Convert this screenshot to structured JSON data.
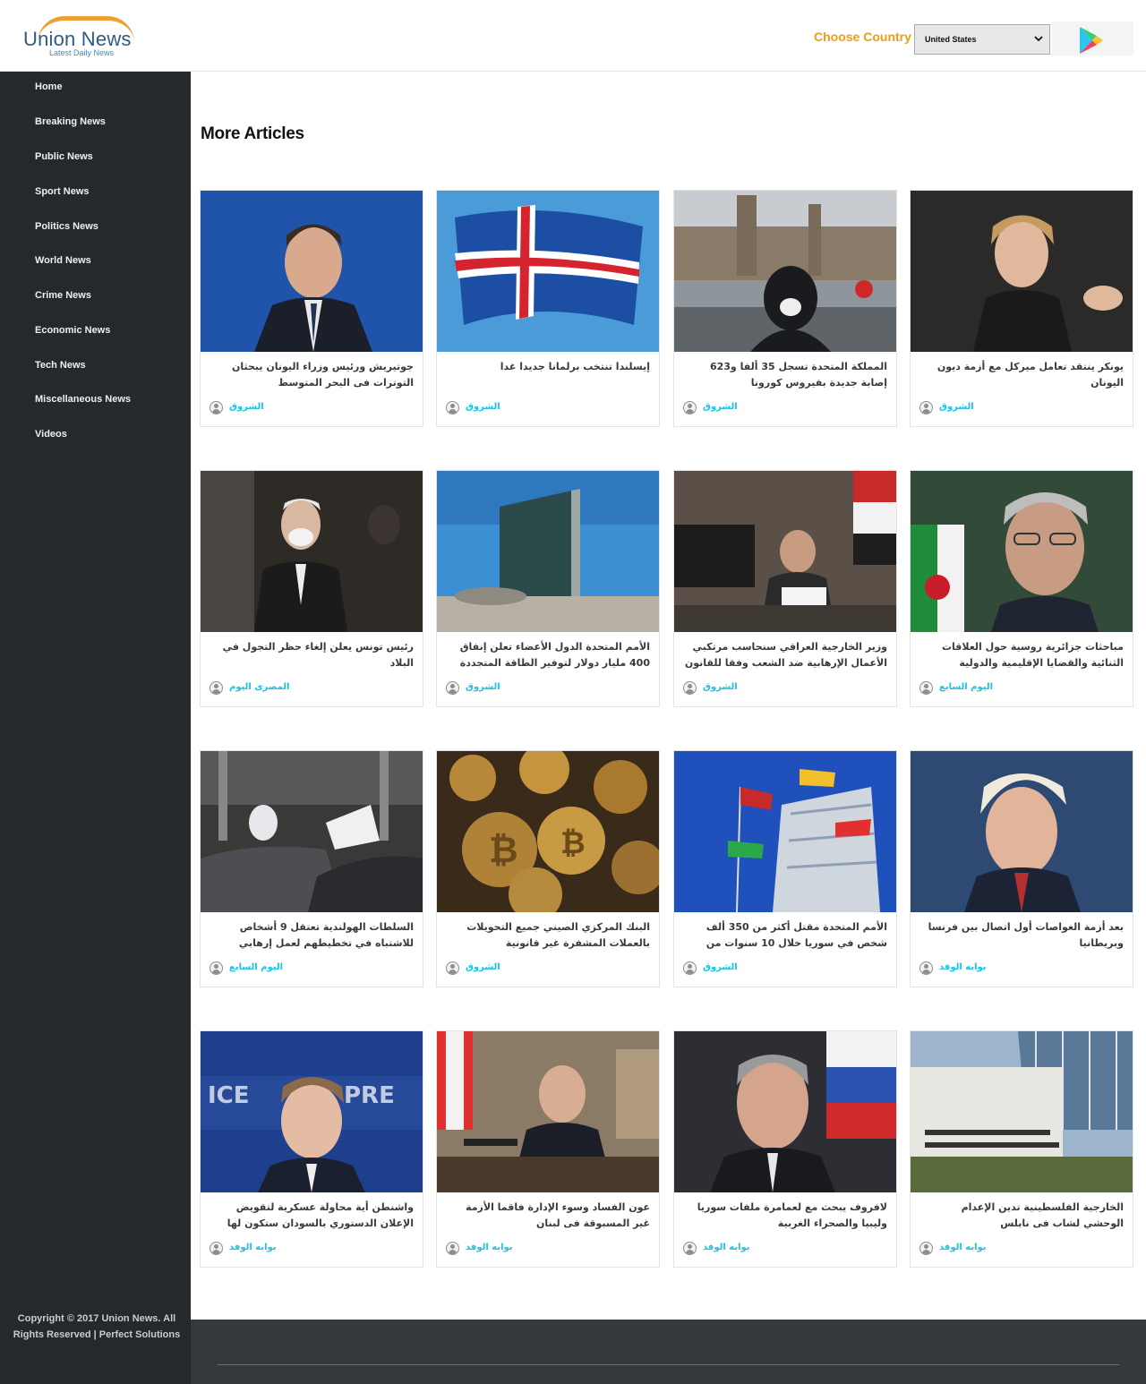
{
  "header": {
    "logo_name": "Union News",
    "logo_tagline": "Latest Daily News",
    "country_label": "Choose Country :",
    "country_selected": "United States",
    "play_icon": "google-play-icon"
  },
  "sidebar": {
    "items": [
      {
        "label": "Home"
      },
      {
        "label": "Breaking News"
      },
      {
        "label": "Public News"
      },
      {
        "label": "Sport News"
      },
      {
        "label": "Politics News"
      },
      {
        "label": "World News"
      },
      {
        "label": "Crime News"
      },
      {
        "label": "Economic News"
      },
      {
        "label": "Tech News"
      },
      {
        "label": "Miscellaneous News"
      },
      {
        "label": "Videos"
      }
    ],
    "copyright_line1": "Copyright © 2017 Union News. All",
    "copyright_line2": "Rights Reserved | Perfect Solutions"
  },
  "main": {
    "section_title": "More Articles",
    "articles": [
      {
        "title": "جوتيريش ورئيس وزراء اليونان يبحثان التوترات فى البحر المتوسط",
        "source": "الشروق"
      },
      {
        "title": "إيسلندا تنتخب برلمانا جديدا غدا",
        "source": "الشروق"
      },
      {
        "title": "المملكة المتحدة تسجل 35 ألفا و623 إصابة جديدة بفيروس كورونا",
        "source": "الشروق"
      },
      {
        "title": "يونكر ينتقد تعامل ميركل مع أزمة ديون اليونان",
        "source": "الشروق"
      },
      {
        "title": "رئيس تونس يعلن إلغاء حظر التجول في البلاد",
        "source": "المصرى اليوم"
      },
      {
        "title": "الأمم المتحدة الدول الأعضاء تعلن إنفاق 400 مليار دولار لتوفير الطاقة المتجددة",
        "source": "الشروق"
      },
      {
        "title": "وزير الخارجية العراقي سنحاسب مرتكبي الأعمال الإرهابية ضد الشعب وفقا للقانون",
        "source": "الشروق"
      },
      {
        "title": "مباحثات جزائرية روسية حول العلاقات الثنائية والقضايا الإقليمية والدولية",
        "source": "اليوم السابع"
      },
      {
        "title": "السلطات الهولندية تعتقل 9 أشخاص للاشتباه في تخطيطهم لعمل إرهابي",
        "source": "اليوم السابع"
      },
      {
        "title": "البنك المركزي الصيني جميع التحويلات بالعملات المشفرة غير قانونية",
        "source": "الشروق"
      },
      {
        "title": "الأمم المتحدة مقتل أكثر من 350 ألف شخص في سوريا خلال 10 سنوات من الحرب",
        "source": "الشروق"
      },
      {
        "title": "بعد أزمة الغواصات أول اتصال بين فرنسا وبريطانيا",
        "source": "بوابه الوفد"
      },
      {
        "title": "واشنطن أية محاولة عسكرية لتقويض الإعلان الدستوري بالسودان ستكون لها عواقب خطيرة",
        "source": "بوابه الوفد"
      },
      {
        "title": "عون الفساد وسوء الإدارة فاقما الأزمة غير المسبوقة فى لبنان",
        "source": "بوابه الوفد"
      },
      {
        "title": "لافروف يبحث مع لعمامرة ملفات سوريا وليبيا والصحراء الغربية",
        "source": "بوابه الوفد"
      },
      {
        "title": "الخارجية الفلسطينية تدين الإعدام الوحشي لشاب فى نابلس",
        "source": "بوابه الوفد"
      }
    ]
  },
  "colors": {
    "accent_orange": "#f29b12",
    "source_cyan": "#19c3e6",
    "sidebar_bg": "#25282c"
  }
}
